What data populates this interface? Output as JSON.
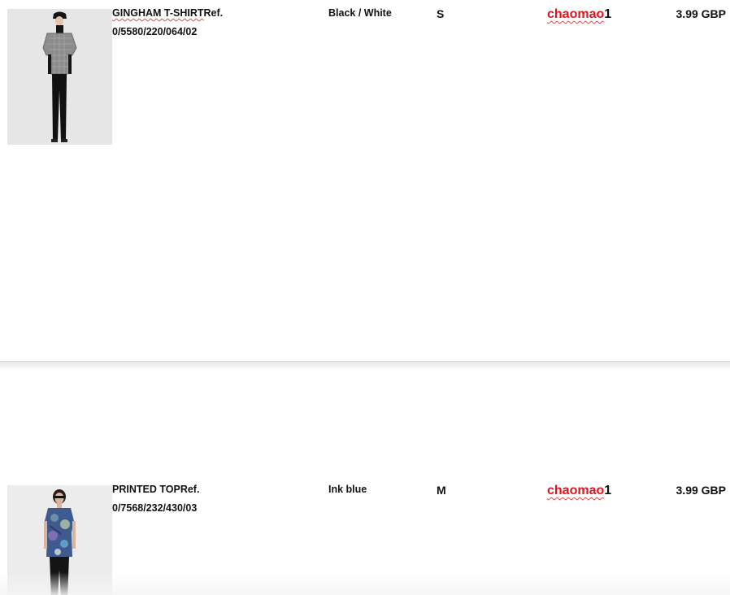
{
  "items": [
    {
      "name": "GINGHAM T-SHIRT",
      "name_suffix": "Ref.",
      "ref": "0/5580/220/064/02",
      "color": "Black / White",
      "size": "S",
      "coupon_text": "chaomao",
      "coupon_digit": "1",
      "price": "3.99 GBP",
      "image": {
        "alt": "model wearing grey gingham t-shirt and black trousers",
        "top_color": "#8c8c8c",
        "background": "#e6e6e6"
      }
    },
    {
      "name": "PRINTED TOP",
      "name_suffix": "Ref.",
      "ref": "0/7568/232/430/03",
      "color": "Ink blue",
      "size": "M",
      "coupon_text": "chaomao",
      "coupon_digit": "1",
      "price": "3.99 GBP",
      "image": {
        "alt": "model wearing blue printed top and black trousers",
        "top_color": "#3f5a8f",
        "background": "#ececec"
      }
    }
  ],
  "colors": {
    "coupon": "#e0141e",
    "spellcheck_underline": "#d94b4b",
    "divider": "#e9e9e9"
  }
}
